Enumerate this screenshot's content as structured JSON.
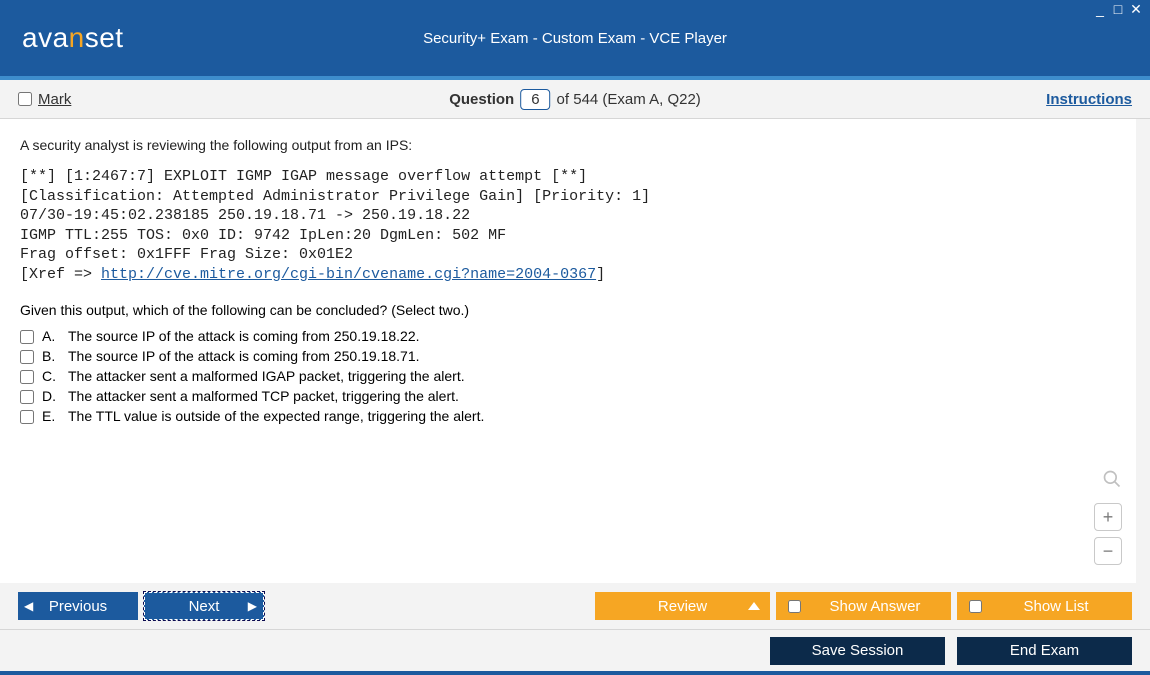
{
  "titlebar": {
    "logo_a": "ava",
    "logo_n": "n",
    "logo_b": "set",
    "title": "Security+ Exam - Custom Exam - VCE Player"
  },
  "infobar": {
    "mark_label": "Mark",
    "question_label": "Question",
    "question_number": "6",
    "total_suffix": "of 544 (Exam A, Q22)",
    "instructions": "Instructions"
  },
  "question": {
    "intro": "A security analyst is reviewing the following output from an IPS:",
    "code_line1": "[**] [1:2467:7] EXPLOIT IGMP IGAP message overflow attempt [**]",
    "code_line2": "[Classification: Attempted Administrator Privilege Gain] [Priority: 1]",
    "code_line3": "07/30-19:45:02.238185 250.19.18.71 -> 250.19.18.22",
    "code_line4": "IGMP TTL:255 TOS: 0x0 ID: 9742 IpLen:20 DgmLen: 502 MF",
    "code_line5": "Frag offset: 0x1FFF Frag Size: 0x01E2",
    "code_line6_prefix": "[Xref => ",
    "code_link": "http://cve.mitre.org/cgi-bin/cvename.cgi?name=2004-0367",
    "code_line6_suffix": "]",
    "prompt": "Given this output, which of the following can be concluded? (Select two.)",
    "options": [
      {
        "letter": "A.",
        "text": "The source IP of the attack is coming from 250.19.18.22."
      },
      {
        "letter": "B.",
        "text": "The source IP of the attack is coming from 250.19.18.71."
      },
      {
        "letter": "C.",
        "text": "The attacker sent a malformed IGAP packet, triggering the alert."
      },
      {
        "letter": "D.",
        "text": "The attacker sent a malformed TCP packet, triggering the alert."
      },
      {
        "letter": "E.",
        "text": "The TTL value is outside of the expected range, triggering the alert."
      }
    ]
  },
  "navbar": {
    "previous": "Previous",
    "next": "Next",
    "review": "Review",
    "show_answer": "Show Answer",
    "show_list": "Show List"
  },
  "bottombar": {
    "save_session": "Save Session",
    "end_exam": "End Exam"
  }
}
